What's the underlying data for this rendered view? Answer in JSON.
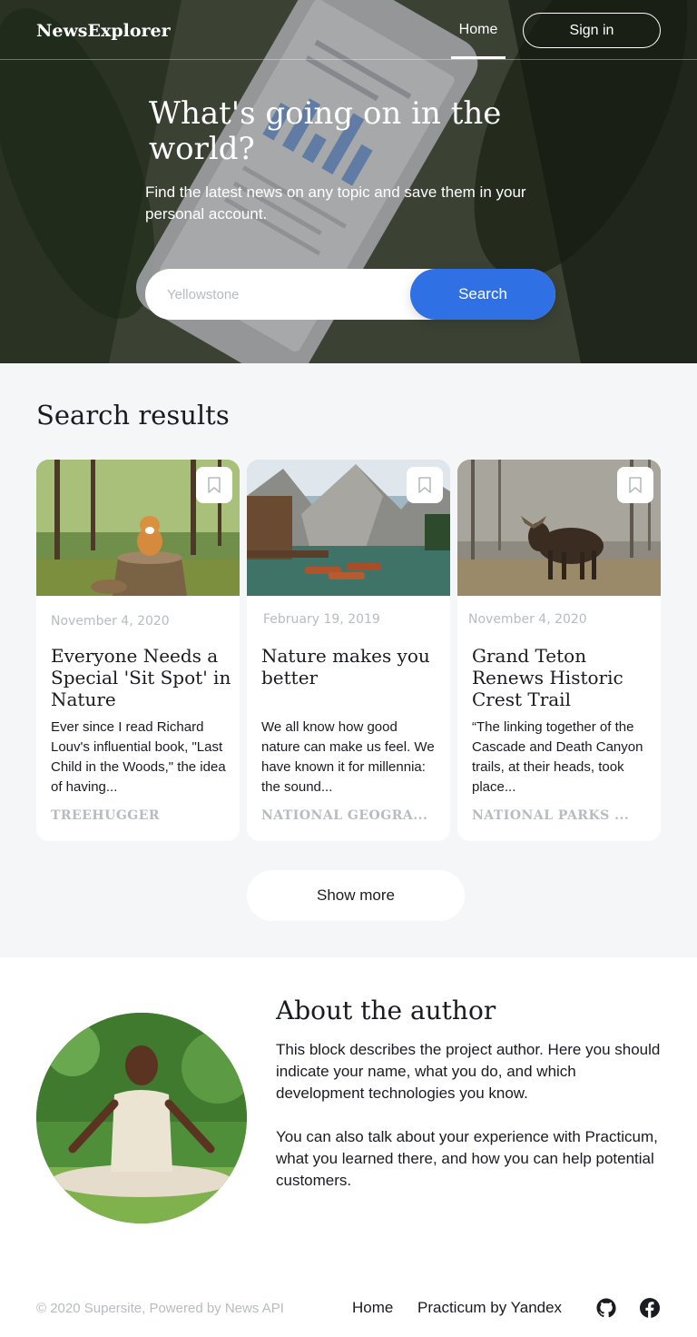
{
  "header": {
    "logo": "NewsExplorer",
    "nav_home": "Home",
    "signin": "Sign in"
  },
  "hero": {
    "title": "What's going on in the world?",
    "subtitle": "Find the latest news on any topic and save them in your personal account.",
    "search_placeholder": "Yellowstone",
    "search_button": "Search"
  },
  "results": {
    "title": "Search results",
    "cards": [
      {
        "date": "November 4, 2020",
        "title": "Everyone Needs a Special 'Sit Spot' in Nature",
        "text": "Ever since I read Richard Louv's influential book, \"Last Child in the Woods,\" the idea of having...",
        "source": "TREEHUGGER",
        "icon": "bookmark-icon"
      },
      {
        "date": "February 19, 2019",
        "title": "Nature makes you better",
        "text": "We all know how good nature can make us feel. We have known it for millennia: the sound...",
        "source": "NATIONAL GEOGRA...",
        "icon": "bookmark-icon"
      },
      {
        "date": "November 4, 2020",
        "title": "Grand Teton Renews Historic Crest Trail",
        "text": "“The linking together of the Cascade and Death Canyon trails, at their heads, took place...",
        "source": "NATIONAL PARKS ...",
        "icon": "bookmark-icon"
      }
    ],
    "show_more": "Show more"
  },
  "about": {
    "title": "About the author",
    "paragraph1": "This block describes the project author. Here you should indicate your name, what you do, and which development technologies you know.",
    "paragraph2": "You can also talk about your experience with Practicum, what you learned there, and how you can help potential customers."
  },
  "footer": {
    "copyright": "© 2020 Supersite, Powered by News API",
    "link_home": "Home",
    "link_practicum": "Practicum by Yandex",
    "icons": [
      "github-icon",
      "facebook-icon"
    ]
  },
  "colors": {
    "accent": "#2f71e5",
    "text": "#1a1b22",
    "muted": "#b6bcbf",
    "section_bg": "#f5f6f7"
  }
}
